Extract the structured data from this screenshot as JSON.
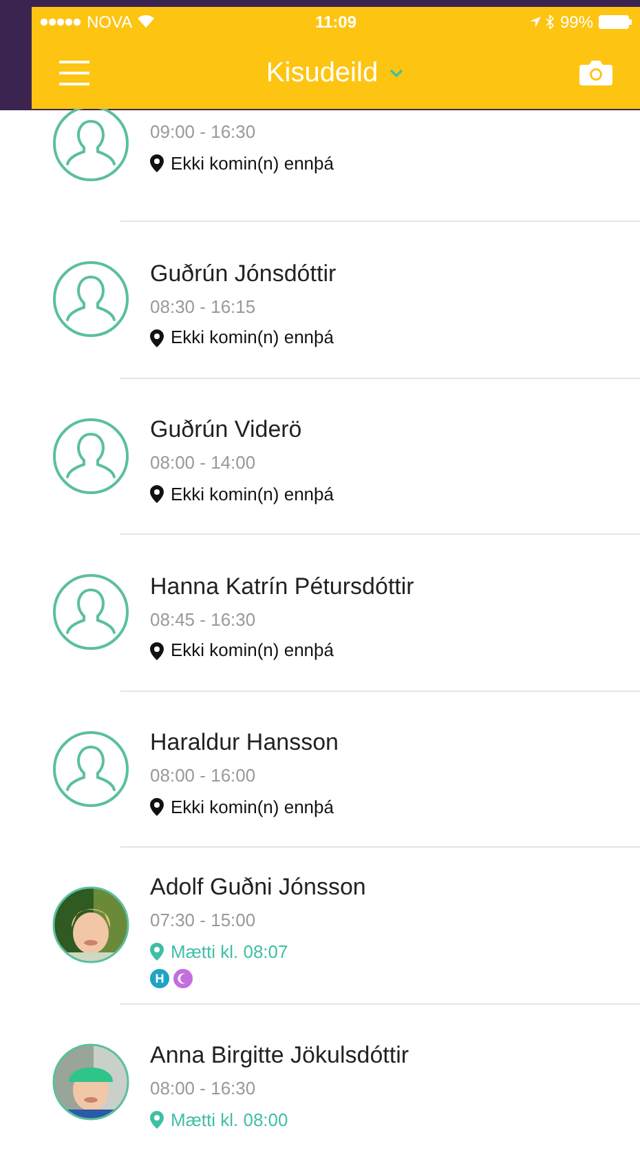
{
  "status_bar": {
    "carrier": "NOVA",
    "time": "11:09",
    "battery": "99%"
  },
  "header": {
    "title": "Kisudeild"
  },
  "children": [
    {
      "kind": "placeholder",
      "hours": "09:00 - 16:30",
      "status": "Ekki komin(n) ennþá",
      "arrived": false
    },
    {
      "kind": "placeholder",
      "name": "Guðrún Jónsdóttir",
      "hours": "08:30 - 16:15",
      "status": "Ekki komin(n) ennþá",
      "arrived": false
    },
    {
      "kind": "placeholder",
      "name": "Guðrún Viderö",
      "hours": "08:00 - 14:00",
      "status": "Ekki komin(n) ennþá",
      "arrived": false
    },
    {
      "kind": "placeholder",
      "name": "Hanna Katrín Pétursdóttir",
      "hours": "08:45 - 16:30",
      "status": "Ekki komin(n) ennþá",
      "arrived": false
    },
    {
      "kind": "placeholder",
      "name": "Haraldur Hansson",
      "hours": "08:00 - 16:00",
      "status": "Ekki komin(n) ennþá",
      "arrived": false
    },
    {
      "kind": "picture",
      "name": "Adolf Guðni Jónsson",
      "hours": "07:30 - 15:00",
      "status": "Mætti kl. 08:07",
      "arrived": true,
      "badges": [
        {
          "kind": "letter",
          "text": "H",
          "color": "#1fa3c4"
        },
        {
          "kind": "moon",
          "color": "#c36ee0"
        }
      ]
    },
    {
      "kind": "picture",
      "name": "Anna Birgitte Jökulsdóttir",
      "hours": "08:00 - 16:30",
      "status": "Mætti kl. 08:00",
      "arrived": true
    }
  ]
}
